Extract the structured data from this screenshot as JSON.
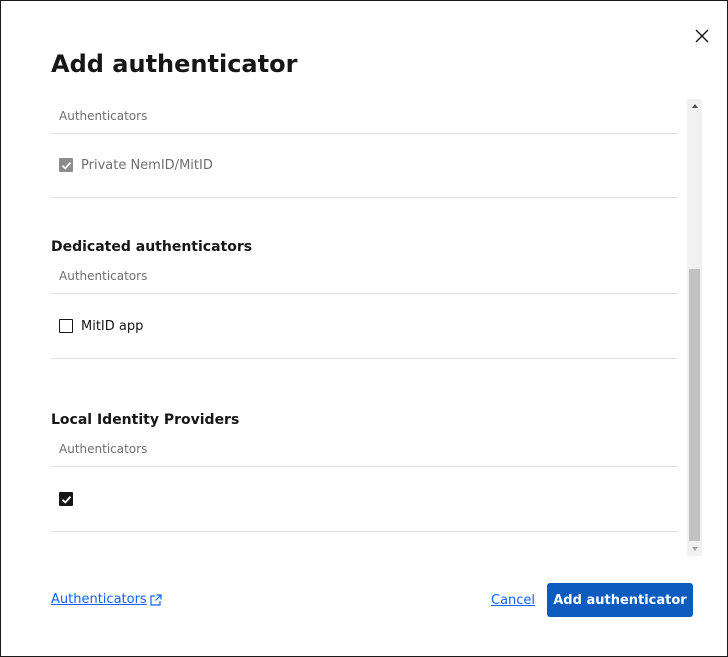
{
  "dialog": {
    "title": "Add authenticator",
    "close_icon": "close-icon"
  },
  "sections": [
    {
      "heading": "",
      "column_header": "Authenticators",
      "rows": [
        {
          "label": "Private NemID/MitID",
          "checked": true,
          "disabled": true
        }
      ]
    },
    {
      "heading": "Dedicated authenticators",
      "column_header": "Authenticators",
      "rows": [
        {
          "label": "MitID app",
          "checked": false,
          "disabled": false
        }
      ]
    },
    {
      "heading": "Local Identity Providers",
      "column_header": "Authenticators",
      "rows": [
        {
          "label": "",
          "checked": true,
          "disabled": false
        }
      ]
    }
  ],
  "footer": {
    "docs_link": "Authenticators",
    "docs_link_icon": "external-link-icon",
    "cancel_label": "Cancel",
    "submit_label": "Add authenticator"
  },
  "colors": {
    "primary": "#0c5cbf",
    "link": "#0f62fe",
    "border": "#e0e0e0",
    "muted_text": "#6f6f6f"
  }
}
